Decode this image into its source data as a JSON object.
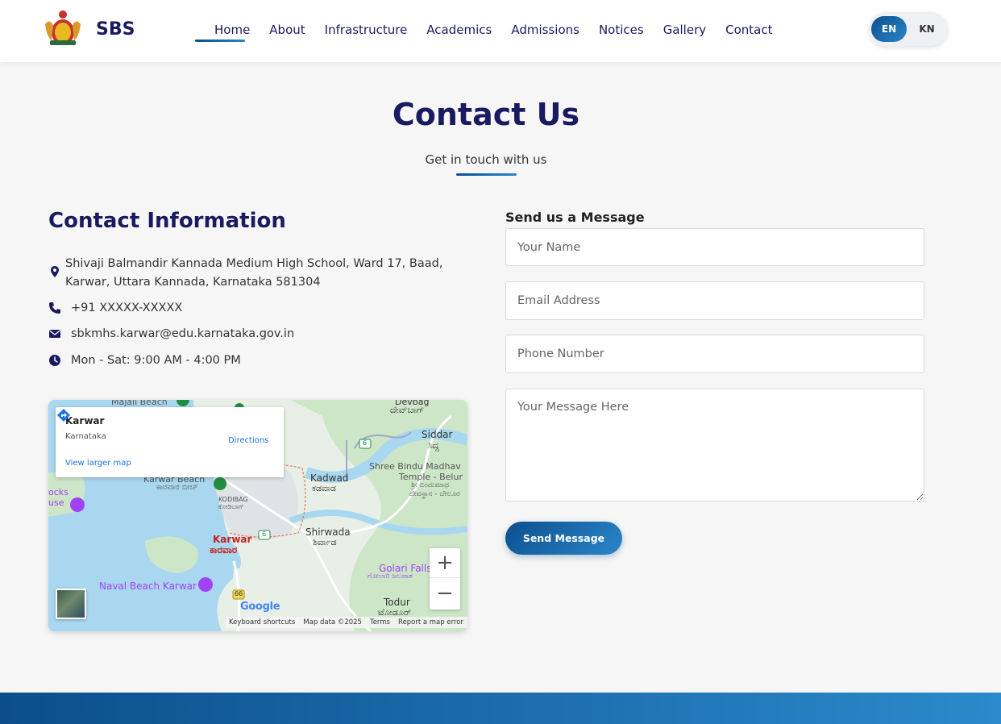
{
  "header": {
    "brand": "SBS",
    "nav": [
      {
        "label": "Home"
      },
      {
        "label": "About"
      },
      {
        "label": "Infrastructure"
      },
      {
        "label": "Academics"
      },
      {
        "label": "Admissions"
      },
      {
        "label": "Notices"
      },
      {
        "label": "Gallery"
      },
      {
        "label": "Contact"
      }
    ],
    "lang": {
      "en": "EN",
      "kn": "KN"
    }
  },
  "page": {
    "title": "Contact Us",
    "subtitle": "Get in touch with us"
  },
  "contact_info": {
    "heading": "Contact Information",
    "address_line1": "Shivaji Balmandir Kannada Medium High School, Ward 17, Baad,",
    "address_line2": "Karwar, Uttara Kannada, Karnataka 581304",
    "phone": "+91 XXXXX-XXXXX",
    "email": "sbkmhs.karwar@edu.karnataka.gov.in",
    "hours": "Mon - Sat: 9:00 AM - 4:00 PM"
  },
  "map": {
    "place_title": "Karwar",
    "place_sub": "Karnataka",
    "directions": "Directions",
    "view_larger": "View larger map",
    "labels": {
      "majali": "Majali Beach",
      "devbag": "Devbag",
      "devbag_kn": "ದೇವ್‌ಬಾಗ್",
      "siddar": "Siddar",
      "siddar_kn": "ಸಿದ್ದ",
      "shree": "Shree Bindu Madhav",
      "temple": "Temple - Belur",
      "temple_kn1": "ಶ್ರೀ ಬಿಂದುಮಾಧ",
      "temple_kn2": "ದೇವಸ್ಥಾನ - ಬೇಲೂರ",
      "karwar_beach": "Karwar Beach",
      "karwar_beach_kn": "ಕಾರವಾರ ಬೀಚ್",
      "kodibag": "KODIBAG",
      "kodibag_kn": "ಕೋಡಿಬಾಗ್",
      "kadwad": "Kadwad",
      "kadwad_kn": "ಕಡವಾಡ",
      "karwar": "Karwar",
      "karwar_kn": "ಕಾರವಾರ",
      "shirwada": "Shirwada",
      "shirwada_kn": "ಶಿರ್ವಾಡ",
      "golari": "Golari Falls",
      "golari_kn": "ಗೋಲಾರಿ ಜಲಪಾತ",
      "naval": "Naval Beach Karwar",
      "todur": "Todur",
      "todur_kn": "ಟೋಡೂರ್",
      "ocks": "ocks",
      "use": "use",
      "route6a": "6",
      "route6b": "6",
      "route66": "66"
    },
    "zoom_in": "+",
    "zoom_out": "−",
    "google": "Google",
    "attribution": [
      "Keyboard shortcuts",
      "Map data ©2025",
      "Terms",
      "Report a map error"
    ]
  },
  "form": {
    "heading": "Send us a Message",
    "name_placeholder": "Your Name",
    "email_placeholder": "Email Address",
    "phone_placeholder": "Phone Number",
    "message_placeholder": "Your Message Here",
    "submit": "Send Message"
  },
  "colors": {
    "primary_dark": "#1a1a60",
    "accent_start": "#0d4f8f",
    "accent_end": "#2a86c7"
  },
  "icons": [
    "emblem-logo",
    "location-pin-icon",
    "phone-icon",
    "envelope-icon",
    "clock-icon",
    "directions-icon"
  ]
}
